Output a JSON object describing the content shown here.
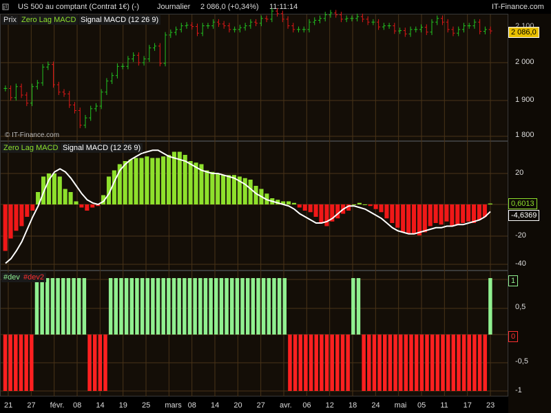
{
  "header": {
    "symbol": "US 500 au comptant (Contrat 1€) (-)",
    "period": "Journalier",
    "price": "2 086,0 (+0,34%)",
    "time": "11:11:14",
    "brand": "IT-Finance.com"
  },
  "price_panel": {
    "legend": [
      "Prix",
      "Zero Lag MACD",
      "Signal MACD (12 26 9)"
    ],
    "watermark": "© IT-Finance.com",
    "yticks": [
      "2 000",
      "1 900",
      "1 800"
    ],
    "last_label": "2 086,0",
    "top_label": "2 100"
  },
  "macd_panel": {
    "legend": [
      "Zero Lag MACD",
      "Signal MACD (12 26 9)"
    ],
    "yticks": [
      "20",
      "-20",
      "-40"
    ],
    "macd_label": "0,6013",
    "signal_label": "-4,6369"
  },
  "dev_panel": {
    "legend": [
      "#dev",
      "#dev2"
    ],
    "yticks": [
      "0,5",
      "-0,5",
      "-1"
    ],
    "top_label": "1",
    "zero_label": "0"
  },
  "xaxis": {
    "labels": [
      "21",
      "27",
      "févr.",
      "08",
      "14",
      "19",
      "25",
      "mars",
      "08",
      "14",
      "20",
      "27",
      "avr.",
      "06",
      "12",
      "18",
      "24",
      "mai",
      "05",
      "11",
      "17",
      "23"
    ]
  },
  "colors": {
    "up": "#22c422",
    "down": "#e01818",
    "hist_up": "#8ee02c",
    "hist_down": "#f01818",
    "dev_up": "#90f090",
    "dev_down": "#ff2020",
    "signal": "#ffffff"
  },
  "chart_data": [
    {
      "type": "line",
      "title": "Prix",
      "ylim": [
        1780,
        2110
      ],
      "close": [
        1930,
        1905,
        1935,
        1912,
        1890,
        1935,
        1945,
        1988,
        1995,
        1940,
        1920,
        1915,
        1885,
        1870,
        1830,
        1850,
        1875,
        1882,
        1920,
        1950,
        1965,
        1990,
        1990,
        2010,
        2020,
        2000,
        2010,
        2040,
        2045,
        1998,
        2075,
        2082,
        2090,
        2100,
        2102,
        2098,
        2080,
        2100,
        2100,
        2110,
        2105,
        2100,
        2090,
        2090,
        2095,
        2100,
        2110,
        2107,
        2120,
        2118,
        2140,
        2133,
        2118,
        2100,
        2090,
        2090,
        2090,
        2110,
        2115,
        2120,
        2130,
        2135,
        2130,
        2118,
        2120,
        2120,
        2125,
        2118,
        2110,
        2110,
        2097,
        2100,
        2100,
        2086,
        2087,
        2078,
        2090,
        2090,
        2096,
        2083,
        2110,
        2120,
        2110,
        2090,
        2080,
        2090,
        2100,
        2100,
        2110,
        2085,
        2090,
        2086
      ]
    },
    {
      "type": "bar",
      "title": "Zero Lag MACD",
      "ylim": [
        -42,
        28
      ],
      "series": [
        {
          "name": "Zero Lag MACD",
          "values": [
            -30,
            -22,
            -17,
            -14,
            -8,
            -4,
            8,
            18,
            20,
            20,
            18,
            10,
            8,
            2,
            -2,
            -4,
            -2,
            -1,
            6,
            18,
            22,
            26,
            28,
            29,
            30,
            30,
            31,
            30,
            30,
            31,
            32,
            34,
            34,
            32,
            28,
            27,
            26,
            22,
            21,
            20,
            19,
            19,
            19,
            18,
            17,
            16,
            12,
            10,
            7,
            4,
            3,
            2,
            2,
            1,
            -2,
            -4,
            -5,
            -8,
            -12,
            -14,
            -11,
            -9,
            -6,
            -4,
            0,
            1,
            0,
            -1,
            -3,
            -5,
            -9,
            -12,
            -15,
            -18,
            -19,
            -19,
            -20,
            -18,
            -14,
            -12,
            -13,
            -11,
            -14,
            -13,
            -12,
            -11,
            -12,
            -10,
            -8,
            0.6
          ]
        },
        {
          "name": "Signal MACD (12 26 9)",
          "values": [
            -38,
            -35,
            -30,
            -24,
            -16,
            -8,
            -1,
            8,
            16,
            21,
            23,
            21,
            17,
            12,
            7,
            3,
            1,
            0,
            2,
            7,
            15,
            22,
            26,
            29,
            31,
            33,
            34,
            35,
            35,
            33,
            31,
            30,
            29,
            28,
            26,
            24,
            22,
            21,
            20,
            20,
            19,
            18,
            17,
            15,
            13,
            10,
            7,
            5,
            3,
            2,
            1,
            0,
            -1,
            -3,
            -6,
            -8,
            -10,
            -12,
            -12,
            -11,
            -9,
            -6,
            -3,
            -1,
            -1,
            -2,
            -3,
            -5,
            -7,
            -9,
            -12,
            -15,
            -17,
            -18,
            -19,
            -19,
            -18,
            -17,
            -16,
            -15,
            -15,
            -14,
            -14,
            -13,
            -13,
            -12,
            -11,
            -10,
            -8,
            -4.6
          ]
        }
      ]
    },
    {
      "type": "bar",
      "title": "#dev",
      "ylim": [
        -1,
        1
      ],
      "series": [
        {
          "name": "#dev",
          "values": [
            -1,
            -1,
            -1,
            -1,
            -1,
            -1,
            1,
            1,
            1,
            1,
            1,
            1,
            1,
            1,
            1,
            1,
            -1,
            -1,
            -1,
            -1,
            1,
            1,
            1,
            1,
            1,
            1,
            1,
            1,
            1,
            1,
            1,
            1,
            1,
            1,
            1,
            1,
            1,
            1,
            1,
            1,
            1,
            1,
            1,
            1,
            1,
            1,
            1,
            1,
            1,
            1,
            1,
            1,
            1,
            1,
            -1,
            -1,
            -1,
            -1,
            -1,
            -1,
            -1,
            -1,
            -1,
            -1,
            -1,
            -1,
            1,
            1,
            -1,
            -1,
            -1,
            -1,
            -1,
            -1,
            -1,
            -1,
            -1,
            -1,
            -1,
            -1,
            -1,
            -1,
            -1,
            -1,
            -1,
            -1,
            -1,
            -1,
            -1,
            -1,
            -1,
            -1,
            1
          ]
        }
      ]
    }
  ]
}
